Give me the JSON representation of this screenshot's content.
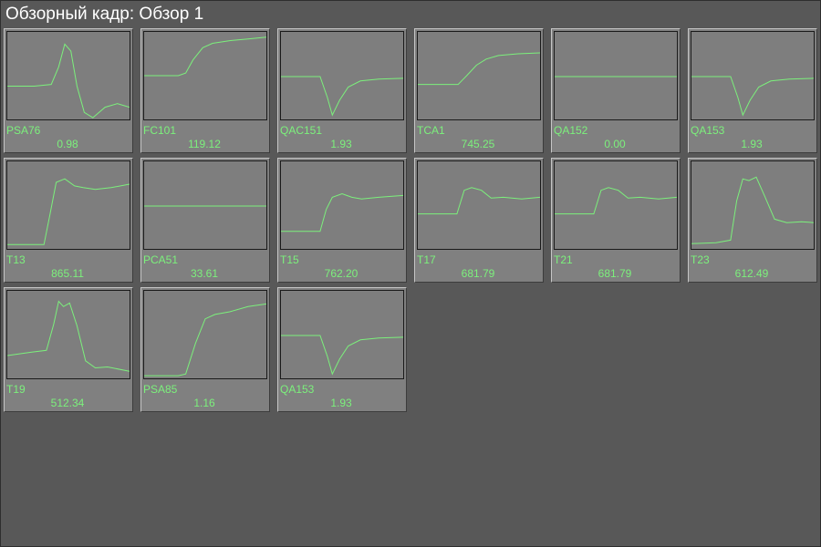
{
  "window": {
    "title": "Обзорный кадр: Обзор 1"
  },
  "colors": {
    "background": "#585858",
    "tile": "#808080",
    "trend": "#7cf07c",
    "title_text": "#ffffff"
  },
  "tiles": [
    {
      "name": "PSA76",
      "value": "0.98",
      "trend": "pulse_narrow"
    },
    {
      "name": "FC101",
      "value": "119.12",
      "trend": "rise_smooth_to_top"
    },
    {
      "name": "QAC151",
      "value": "1.93",
      "trend": "dip_recover"
    },
    {
      "name": "TCA1",
      "value": "745.25",
      "trend": "rise_smooth_mid"
    },
    {
      "name": "QA152",
      "value": "0.00",
      "trend": "flat"
    },
    {
      "name": "QA153",
      "value": "1.93",
      "trend": "dip_recover"
    },
    {
      "name": "T13",
      "value": "865.11",
      "trend": "step_up_overshoot"
    },
    {
      "name": "PCA51",
      "value": "33.61",
      "trend": "flat"
    },
    {
      "name": "T15",
      "value": "762.20",
      "trend": "step_up_bump"
    },
    {
      "name": "T17",
      "value": "681.79",
      "trend": "step_up_bump_high"
    },
    {
      "name": "T21",
      "value": "681.79",
      "trend": "step_up_bump_high"
    },
    {
      "name": "T23",
      "value": "612.49",
      "trend": "double_peak"
    },
    {
      "name": "T19",
      "value": "512.34",
      "trend": "double_peak_wide"
    },
    {
      "name": "PSA85",
      "value": "1.16",
      "trend": "rise_smooth_from_bottom"
    },
    {
      "name": "QA153",
      "value": "1.93",
      "trend": "dip_recover"
    }
  ]
}
